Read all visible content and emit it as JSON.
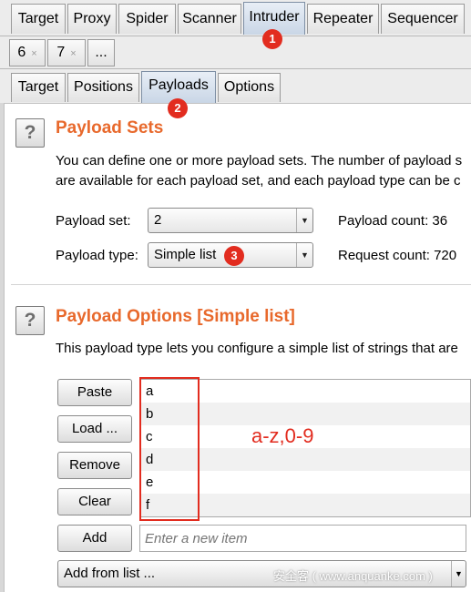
{
  "top_tabs": [
    "Target",
    "Proxy",
    "Spider",
    "Scanner",
    "Intruder",
    "Repeater",
    "Sequencer"
  ],
  "sub_tabs": [
    {
      "label": "6",
      "close": "×"
    },
    {
      "label": "7",
      "close": "×"
    },
    {
      "label": "..."
    }
  ],
  "intruder_tabs": [
    "Target",
    "Positions",
    "Payloads",
    "Options"
  ],
  "payload_sets": {
    "help": "?",
    "title": "Payload Sets",
    "desc_line1": "You can define one or more payload sets. The number of payload s",
    "desc_line2": "are available for each payload set, and each payload type can be c",
    "set_label": "Payload set:",
    "set_value": "2",
    "type_label": "Payload type:",
    "type_value": "Simple list",
    "payload_count": "Payload count: 36",
    "request_count": "Request count: 720"
  },
  "payload_options": {
    "help": "?",
    "title": "Payload Options [Simple list]",
    "desc": "This payload type lets you configure a simple list of strings that are",
    "buttons": {
      "paste": "Paste",
      "load": "Load ...",
      "remove": "Remove",
      "clear": "Clear",
      "add": "Add"
    },
    "items": [
      "a",
      "b",
      "c",
      "d",
      "e",
      "f"
    ],
    "new_item_placeholder": "Enter a new item",
    "add_from_list": "Add from list ..."
  },
  "annotations": {
    "markers": [
      "1",
      "2",
      "3"
    ],
    "range_note": "a-z,0-9",
    "watermark": "安全客 ( www.anquanke.com )",
    "color": "#e22c1f"
  },
  "icons": {
    "dropdown": "▼"
  }
}
